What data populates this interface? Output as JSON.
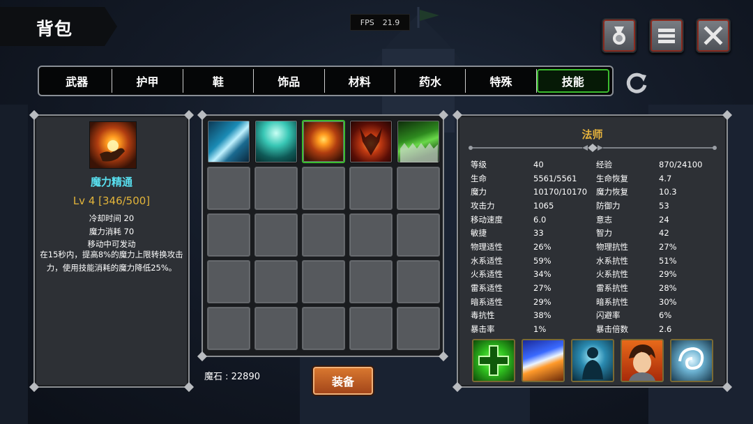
{
  "title": "背包",
  "fps": {
    "label": "FPS",
    "value": "21.9"
  },
  "top_buttons": [
    {
      "icon": "medal-icon"
    },
    {
      "icon": "menu-icon"
    },
    {
      "icon": "close-icon"
    }
  ],
  "tabs": [
    {
      "label": "武器",
      "active": false
    },
    {
      "label": "护甲",
      "active": false
    },
    {
      "label": "鞋",
      "active": false
    },
    {
      "label": "饰品",
      "active": false
    },
    {
      "label": "材料",
      "active": false
    },
    {
      "label": "药水",
      "active": false
    },
    {
      "label": "特殊",
      "active": false
    },
    {
      "label": "技能",
      "active": true
    }
  ],
  "selected_skill": {
    "name": "魔力精通",
    "level": "Lv 4 [346/500]",
    "cooldown": "冷却时间 20",
    "mana_cost": "魔力消耗 70",
    "movable": "移动中可发动",
    "description": "在15秒内，提高8%的魔力上限转换攻击力，使用技能消耗的魔力降低25%。"
  },
  "inventory": {
    "slots": [
      {
        "icon": "water-wave-skill-icon"
      },
      {
        "icon": "ice-splash-skill-icon"
      },
      {
        "icon": "mana-mastery-skill-icon",
        "selected": true
      },
      {
        "icon": "fire-demon-skill-icon"
      },
      {
        "icon": "green-jaw-skill-icon"
      }
    ],
    "rows": 5,
    "cols": 5
  },
  "currency": {
    "label": "魔石 : 22890"
  },
  "equip_label": "装备",
  "character": {
    "class": "法师",
    "stats": [
      [
        "等级",
        "40",
        "经验",
        "870/24100"
      ],
      [
        "生命",
        "5561/5561",
        "生命恢复",
        "4.7"
      ],
      [
        "魔力",
        "10170/10170",
        "魔力恢复",
        "10.3"
      ],
      [
        "攻击力",
        "1065",
        "防御力",
        "53"
      ],
      [
        "移动速度",
        "6.0",
        "意志",
        "24"
      ],
      [
        "敏捷",
        "33",
        "智力",
        "42"
      ],
      [
        "物理适性",
        "26%",
        "物理抗性",
        "27%"
      ],
      [
        "水系适性",
        "59%",
        "水系抗性",
        "51%"
      ],
      [
        "火系适性",
        "34%",
        "火系抗性",
        "29%"
      ],
      [
        "雷系适性",
        "27%",
        "雷系抗性",
        "28%"
      ],
      [
        "暗系适性",
        "29%",
        "暗系抗性",
        "30%"
      ],
      [
        "毒抗性",
        "38%",
        "闪避率",
        "6%"
      ],
      [
        "暴击率",
        "1%",
        "暴击倍数",
        "2.6"
      ]
    ],
    "equipped_skills": [
      {
        "icon": "heal-cross-skill-icon"
      },
      {
        "icon": "light-beam-skill-icon"
      },
      {
        "icon": "spirit-form-skill-icon"
      },
      {
        "icon": "hero-portrait-icon"
      },
      {
        "icon": "tornado-skill-icon"
      }
    ]
  },
  "colors": {
    "active_tab": "#3bbd2f",
    "skill_name": "#58e0f0",
    "skill_level": "#e2b43a",
    "class_title": "#e8b43c",
    "equip_button": "#c35f25"
  }
}
